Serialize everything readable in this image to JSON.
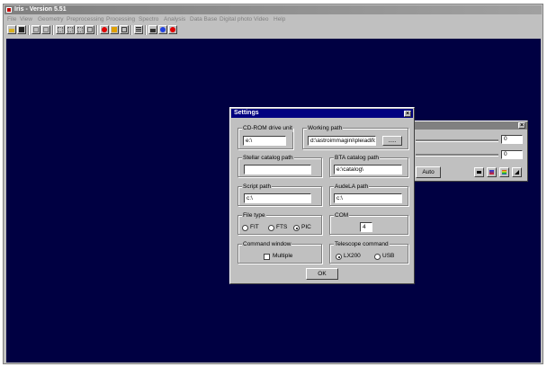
{
  "window": {
    "title": "Iris - Version 5.51"
  },
  "menu": [
    "File",
    "View",
    "Geometry",
    "Preprocessing",
    "Processing",
    "Spectro",
    "Analysis",
    "Data Base",
    "Digital photo",
    "Video",
    "Help"
  ],
  "toolbar_icons": [
    "open-folder-icon",
    "save-icon",
    "undo-icon",
    "redo-icon",
    "zoom-icon",
    "zoom-out-icon",
    "zoom-in-icon",
    "fit-icon",
    "stop-icon",
    "color-icon",
    "grid-icon",
    "list-icon",
    "camera-icon",
    "crosshair-icon",
    "record-icon"
  ],
  "threshold_panel": {
    "high_value": "0",
    "low_value": "0",
    "auto_label": "Auto"
  },
  "settings": {
    "title": "Settings",
    "close_glyph": "×",
    "cdrom": {
      "label": "CD-ROM drive unit",
      "value": "e:\\"
    },
    "working": {
      "label": "Working path",
      "value": "d:\\astroimmagini\\pleiadifont",
      "browse": "....."
    },
    "stellar": {
      "label": "Stellar catalog path",
      "value": ""
    },
    "bta": {
      "label": "BTA catalog path",
      "value": "e:\\catalog\\"
    },
    "script": {
      "label": "Script path",
      "value": "c:\\"
    },
    "audela": {
      "label": "AudeLA path",
      "value": "c:\\"
    },
    "filetype": {
      "label": "File type",
      "options": [
        "FIT",
        "FTS",
        "PIC"
      ],
      "selected": "PIC"
    },
    "com": {
      "label": "COM",
      "value": "4"
    },
    "cmdwin": {
      "label": "Command window",
      "checkbox": "Multiple"
    },
    "telescope": {
      "label": "Telescope command",
      "options": [
        "LX200",
        "USB"
      ],
      "selected": "LX200"
    },
    "ok_label": "OK"
  }
}
